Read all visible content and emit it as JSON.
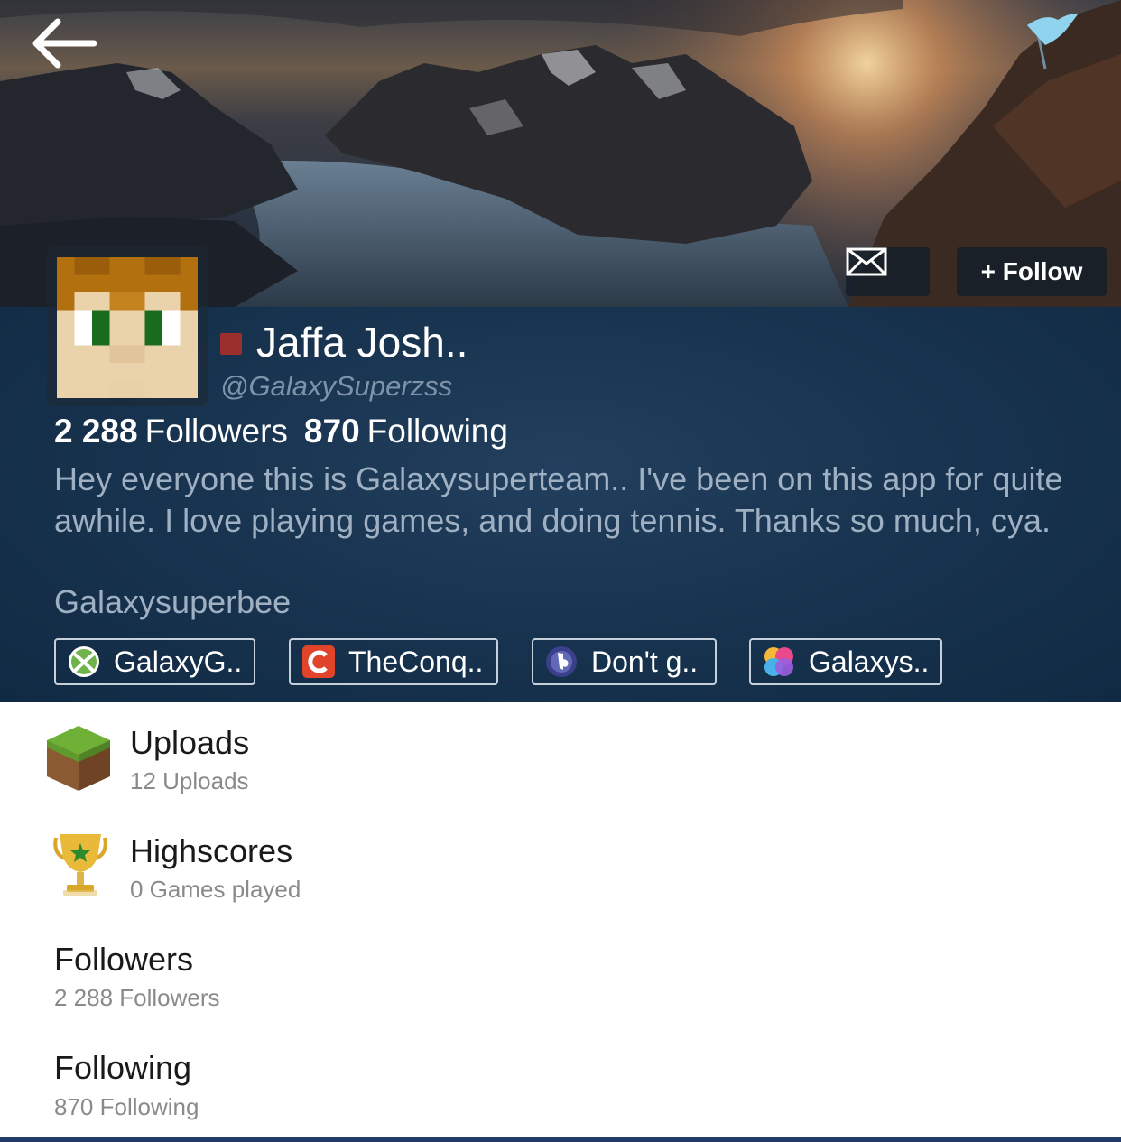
{
  "header": {
    "back_icon": "arrow-left-icon",
    "flag_icon": "flag-icon",
    "message_icon": "envelope-icon",
    "follow_label": "+ Follow"
  },
  "profile": {
    "name": "Jaffa Josh..",
    "handle": "@GalaxySuperzss",
    "status_color": "#9b2f2e",
    "followers_count": "2 288",
    "followers_label": "Followers",
    "following_count": "870",
    "following_label": "Following",
    "bio": "Hey everyone this is Galaxysuperteam.. I've been on this app for quite awhile. I love playing games, and doing tennis. Thanks so much, cya.",
    "bio_signature": "Galaxysuperbee"
  },
  "accounts": [
    {
      "icon": "xbox-icon",
      "label": "GalaxyG.."
    },
    {
      "icon": "app-logo-icon",
      "label": "TheConq.."
    },
    {
      "icon": "playstation-icon",
      "label": "Don't g.."
    },
    {
      "icon": "game-center-icon",
      "label": "Galaxys.."
    }
  ],
  "sections": {
    "uploads": {
      "icon": "grass-block-icon",
      "title": "Uploads",
      "subtitle": "12 Uploads"
    },
    "highscores": {
      "icon": "trophy-icon",
      "title": "Highscores",
      "subtitle": "0 Games played"
    },
    "followers": {
      "title": "Followers",
      "subtitle": "2 288 Followers"
    },
    "following": {
      "title": "Following",
      "subtitle": "870 Following"
    }
  },
  "colors": {
    "panel_bg": "#183450",
    "accent_bar": "#1f3b6a",
    "flag": "#8fd3ef"
  }
}
